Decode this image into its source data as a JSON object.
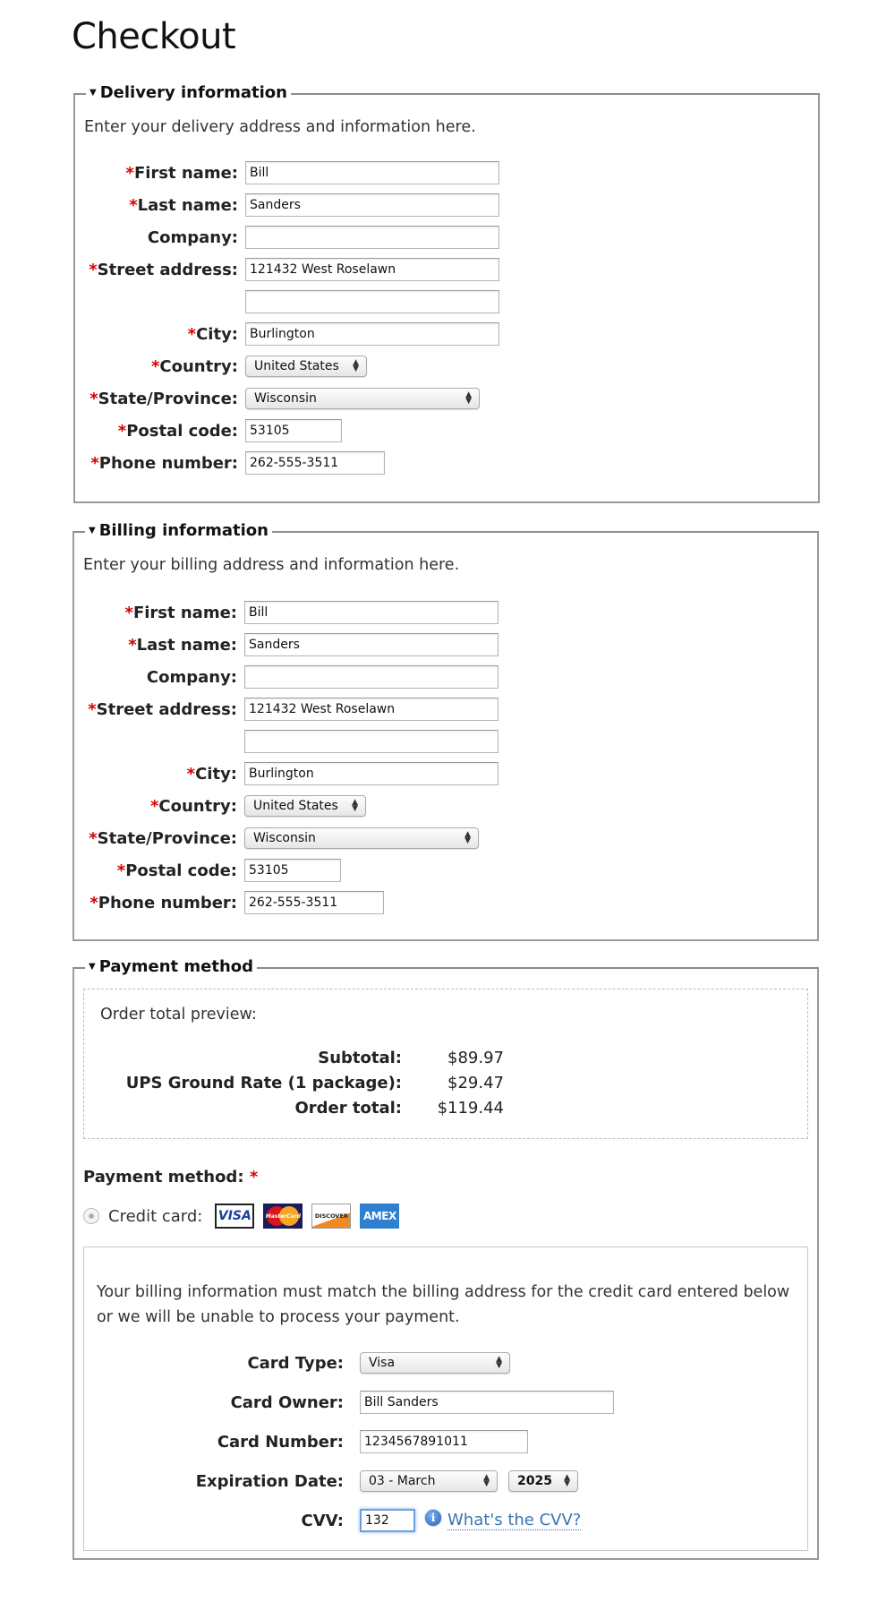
{
  "page": {
    "title": "Checkout"
  },
  "delivery": {
    "legend": "Delivery information",
    "intro": "Enter your delivery address and information here.",
    "fields": {
      "first_name": {
        "label": "First name:",
        "value": "Bill",
        "required": true
      },
      "last_name": {
        "label": "Last name:",
        "value": "Sanders",
        "required": true
      },
      "company": {
        "label": "Company:",
        "value": "",
        "required": false
      },
      "street": {
        "label": "Street address:",
        "value": "121432 West Roselawn",
        "value2": "",
        "required": true
      },
      "city": {
        "label": "City:",
        "value": "Burlington",
        "required": true
      },
      "country": {
        "label": "Country:",
        "value": "United States",
        "required": true
      },
      "state": {
        "label": "State/Province:",
        "value": "Wisconsin",
        "required": true
      },
      "postal": {
        "label": "Postal code:",
        "value": "53105",
        "required": true
      },
      "phone": {
        "label": "Phone number:",
        "value": "262-555-3511",
        "required": true
      }
    }
  },
  "billing": {
    "legend": "Billing information",
    "intro": "Enter your billing address and information here.",
    "fields": {
      "first_name": {
        "label": "First name:",
        "value": "Bill",
        "required": true
      },
      "last_name": {
        "label": "Last name:",
        "value": "Sanders",
        "required": true
      },
      "company": {
        "label": "Company:",
        "value": "",
        "required": false
      },
      "street": {
        "label": "Street address:",
        "value": "121432 West Roselawn",
        "value2": "",
        "required": true
      },
      "city": {
        "label": "City:",
        "value": "Burlington",
        "required": true
      },
      "country": {
        "label": "Country:",
        "value": "United States",
        "required": true
      },
      "state": {
        "label": "State/Province:",
        "value": "Wisconsin",
        "required": true
      },
      "postal": {
        "label": "Postal code:",
        "value": "53105",
        "required": true
      },
      "phone": {
        "label": "Phone number:",
        "value": "262-555-3511",
        "required": true
      }
    }
  },
  "payment": {
    "legend": "Payment method",
    "preview": {
      "title": "Order total preview:",
      "rows": [
        {
          "label": "Subtotal:",
          "value": "$89.97"
        },
        {
          "label": "UPS Ground Rate (1 package):",
          "value": "$29.47"
        },
        {
          "label": "Order total:",
          "value": "$119.44"
        }
      ]
    },
    "method_label": "Payment method:",
    "required_mark": "*",
    "credit_card_label": "Credit card:",
    "card_logos": [
      {
        "name": "visa",
        "text": "VISA"
      },
      {
        "name": "mastercard",
        "text": "MasterCard"
      },
      {
        "name": "discover",
        "text": "DISCOVER"
      },
      {
        "name": "amex",
        "text": "AMEX"
      }
    ],
    "note": "Your billing information must match the billing address for the credit card entered below or we will be unable to process your payment.",
    "card_type": {
      "label": "Card Type:",
      "value": "Visa"
    },
    "card_owner": {
      "label": "Card Owner:",
      "value": "Bill Sanders"
    },
    "card_number": {
      "label": "Card Number:",
      "value": "1234567891011"
    },
    "expiration": {
      "label": "Expiration Date:",
      "month": "03 - March",
      "year": "2025"
    },
    "cvv": {
      "label": "CVV:",
      "value": "132",
      "help_link": "What's the CVV?",
      "info_icon": "i"
    }
  },
  "req_mark": "*"
}
